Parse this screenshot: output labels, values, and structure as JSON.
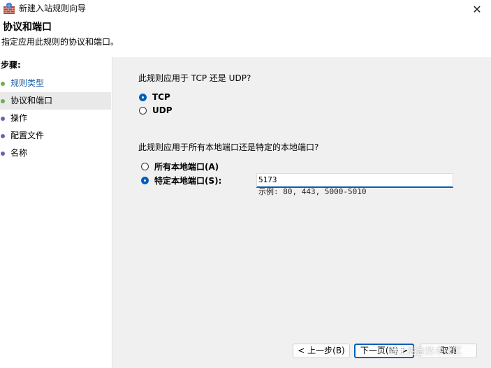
{
  "window": {
    "title": "新建入站规则向导"
  },
  "header": {
    "title": "协议和端口",
    "description": "指定应用此规则的协议和端口。"
  },
  "sidebar": {
    "header": "步骤:",
    "steps": [
      {
        "label": "规则类型",
        "dot_color": "#6ab04c"
      },
      {
        "label": "协议和端口",
        "dot_color": "#6ab04c"
      },
      {
        "label": "操作",
        "dot_color": "#6d5fb8"
      },
      {
        "label": "配置文件",
        "dot_color": "#6d5fb8"
      },
      {
        "label": "名称",
        "dot_color": "#6d5fb8"
      }
    ]
  },
  "protocol": {
    "question": "此规则应用于 TCP 还是 UDP?",
    "options": [
      {
        "label": "TCP",
        "checked": true
      },
      {
        "label": "UDP",
        "checked": false
      }
    ]
  },
  "ports": {
    "question": "此规则应用于所有本地端口还是特定的本地端口?",
    "options": [
      {
        "label": "所有本地端口(A)",
        "checked": false
      },
      {
        "label": "特定本地端口(S):",
        "checked": true
      }
    ],
    "value": "5173",
    "example": "示例: 80, 443, 5000-5010"
  },
  "buttons": {
    "back": "< 上一步(B)",
    "next": "下一页(N) >",
    "cancel": "取消"
  },
  "watermark": "稀土掘金技术社区",
  "colors": {
    "accent": "#005fb8",
    "main_bg": "#f0f0f0"
  }
}
